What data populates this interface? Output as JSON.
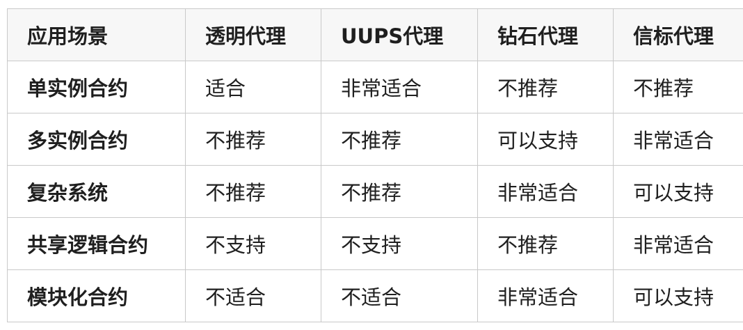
{
  "table": {
    "headers": [
      "应用场景",
      "透明代理",
      "UUPS代理",
      "钻石代理",
      "信标代理"
    ],
    "rows": [
      {
        "scenario": "单实例合约",
        "cells": [
          "适合",
          "非常适合",
          "不推荐",
          "不推荐"
        ]
      },
      {
        "scenario": "多实例合约",
        "cells": [
          "不推荐",
          "不推荐",
          "可以支持",
          "非常适合"
        ]
      },
      {
        "scenario": "复杂系统",
        "cells": [
          "不推荐",
          "不推荐",
          "非常适合",
          "可以支持"
        ]
      },
      {
        "scenario": "共享逻辑合约",
        "cells": [
          "不支持",
          "不支持",
          "不推荐",
          "非常适合"
        ]
      },
      {
        "scenario": "模块化合约",
        "cells": [
          "不适合",
          "不适合",
          "非常适合",
          "可以支持"
        ]
      }
    ]
  }
}
